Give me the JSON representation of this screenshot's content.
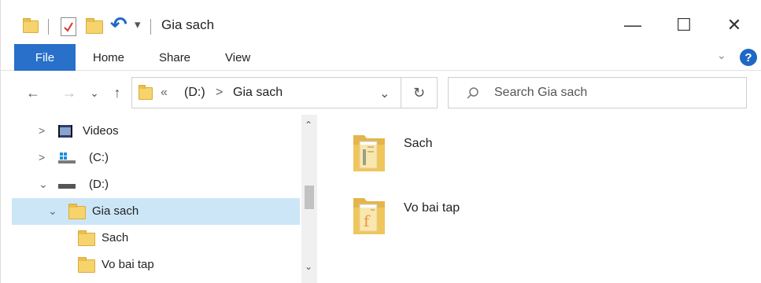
{
  "window": {
    "title": "Gia sach",
    "controls": {
      "minimize": "—",
      "maximize": "☐",
      "close": "✕"
    }
  },
  "quick_access": {
    "dropdown": "▾",
    "undo": "↶"
  },
  "ribbon": {
    "tabs": [
      {
        "label": "File"
      },
      {
        "label": "Home"
      },
      {
        "label": "Share"
      },
      {
        "label": "View"
      }
    ],
    "expand_glyph": "⌄",
    "help_glyph": "?"
  },
  "nav": {
    "back": "←",
    "forward": "→",
    "recent": "⌄",
    "up": "↑",
    "address": {
      "overflow": "«",
      "crumbs": [
        "(D:)",
        ">",
        "Gia sach"
      ],
      "dropdown": "⌄"
    },
    "refresh": "↻",
    "search": {
      "placeholder": "Search Gia sach"
    }
  },
  "tree": [
    {
      "label": "Videos",
      "chevron": ">"
    },
    {
      "label": "(C:)",
      "chevron": ">"
    },
    {
      "label": "(D:)",
      "chevron": "⌄"
    },
    {
      "label": "Gia sach",
      "chevron": "⌄",
      "selected": true
    },
    {
      "label": "Sach",
      "chevron": ""
    },
    {
      "label": "Vo bai tap",
      "chevron": ""
    }
  ],
  "scroll": {
    "up": "⌃",
    "down": "⌄"
  },
  "content": {
    "items": [
      {
        "name": "Sach"
      },
      {
        "name": "Vo bai tap"
      }
    ]
  },
  "colors": {
    "file_tab": "#2870c9",
    "selection": "#cde6f7",
    "folder": "#f6d46b",
    "help": "#1f68c4"
  }
}
